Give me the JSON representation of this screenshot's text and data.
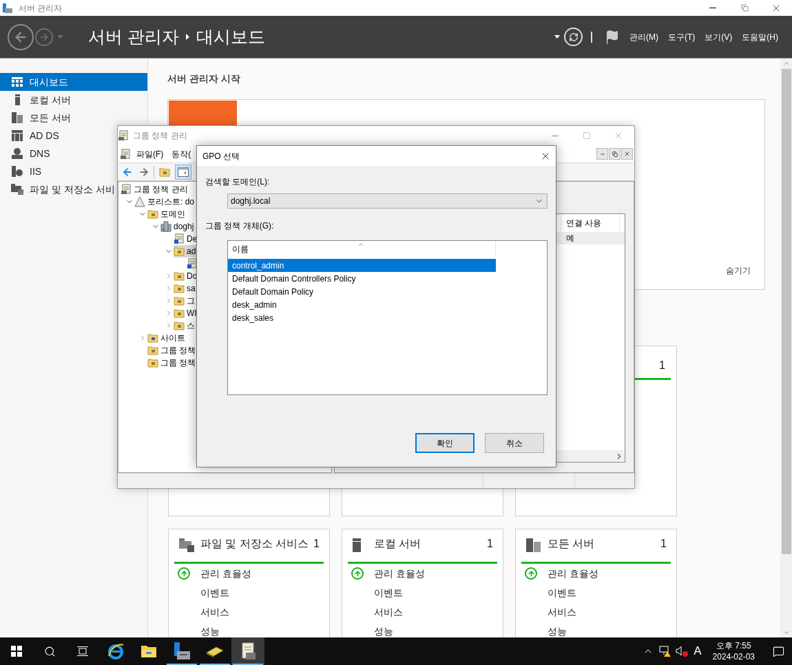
{
  "window": {
    "title": "서버 관리자"
  },
  "header": {
    "breadcrumb": [
      "서버 관리자",
      "대시보드"
    ],
    "menus": [
      "관리(M)",
      "도구(T)",
      "보기(V)",
      "도움말(H)"
    ]
  },
  "sidebar": {
    "items": [
      {
        "label": "대시보드",
        "kind": "dashboard",
        "selected": true
      },
      {
        "label": "로컬 서버",
        "kind": "server",
        "selected": false
      },
      {
        "label": "모든 서버",
        "kind": "servers",
        "selected": false
      },
      {
        "label": "AD DS",
        "kind": "adds",
        "selected": false
      },
      {
        "label": "DNS",
        "kind": "dns",
        "selected": false
      },
      {
        "label": "IIS",
        "kind": "iis",
        "selected": false
      },
      {
        "label": "파일 및 저장소 서비",
        "kind": "files",
        "selected": false
      }
    ]
  },
  "welcome": {
    "title": "서버 관리자 시작",
    "hide_link": "숨기기"
  },
  "middle_tile": {
    "count": "1"
  },
  "tiles": [
    {
      "kind": "files",
      "title": "파일 및 저장소 서비스",
      "count": "1",
      "items": [
        {
          "label": "관리 효율성",
          "ok": true
        },
        {
          "label": "이벤트",
          "ok": false
        },
        {
          "label": "서비스",
          "ok": false
        },
        {
          "label": "성능",
          "ok": false
        }
      ]
    },
    {
      "kind": "server",
      "title": "로컬 서버",
      "count": "1",
      "items": [
        {
          "label": "관리 효율성",
          "ok": true
        },
        {
          "label": "이벤트",
          "ok": false
        },
        {
          "label": "서비스",
          "ok": false
        },
        {
          "label": "성능",
          "ok": false
        }
      ]
    },
    {
      "kind": "servers",
      "title": "모든 서버",
      "count": "1",
      "items": [
        {
          "label": "관리 효율성",
          "ok": true
        },
        {
          "label": "이벤트",
          "ok": false
        },
        {
          "label": "서비스",
          "ok": false
        },
        {
          "label": "성능",
          "ok": false
        }
      ]
    }
  ],
  "gpm": {
    "title": "그룹 정책 관리",
    "menus": [
      "파일(F)",
      "동작("
    ],
    "tree": [
      {
        "label": "그룹 정책 관리",
        "kind": "console",
        "selected": false,
        "children": [
          {
            "label": "포리스트: do",
            "kind": "forest",
            "expanded": true,
            "selected": false,
            "children": [
              {
                "label": "도메인",
                "kind": "domains",
                "expanded": true,
                "selected": false,
                "children": [
                  {
                    "label": "doghj",
                    "kind": "domain",
                    "expanded": true,
                    "selected": false,
                    "children": [
                      {
                        "label": "De",
                        "kind": "link",
                        "selected": false
                      },
                      {
                        "label": "ad",
                        "kind": "ou",
                        "expanded": true,
                        "selected": true,
                        "children": [
                          {
                            "kind": "link",
                            "selected": false
                          }
                        ]
                      },
                      {
                        "label": "Do",
                        "kind": "ou",
                        "expanded": false,
                        "selected": false
                      },
                      {
                        "label": "sa",
                        "kind": "ou",
                        "expanded": false,
                        "selected": false
                      },
                      {
                        "label": "그",
                        "kind": "gpo-folder",
                        "expanded": false,
                        "selected": false
                      },
                      {
                        "label": "WI",
                        "kind": "wmi",
                        "expanded": false,
                        "selected": false
                      },
                      {
                        "label": "스",
                        "kind": "starter",
                        "expanded": false,
                        "selected": false
                      }
                    ]
                  }
                ]
              },
              {
                "label": "사이트",
                "kind": "sites",
                "expanded": false,
                "selected": false
              },
              {
                "label": "그룹 정책",
                "kind": "modeling",
                "selected": false
              },
              {
                "label": "그룹 정책",
                "kind": "results",
                "selected": false
              }
            ]
          }
        ]
      }
    ],
    "columns": [
      "연결 사용"
    ],
    "rows": [
      [
        "예"
      ]
    ]
  },
  "dialog": {
    "title": "GPO 선택",
    "domain_label": "검색할 도메인(L):",
    "domain": "doghj.local",
    "list_label": "그룹 정책 개체(G):",
    "column": "이름",
    "items": [
      {
        "label": "control_admin",
        "selected": true
      },
      {
        "label": "Default Domain Controllers Policy",
        "selected": false
      },
      {
        "label": "Default Domain Policy",
        "selected": false
      },
      {
        "label": "desk_admin",
        "selected": false
      },
      {
        "label": "desk_sales",
        "selected": false
      }
    ],
    "buttons": [
      {
        "label": "확인",
        "default": true
      },
      {
        "label": "취소",
        "default": false
      }
    ]
  },
  "taskbar": {
    "apps": [
      {
        "kind": "ie",
        "running": false,
        "selected": false
      },
      {
        "kind": "explorer",
        "running": false,
        "selected": false
      },
      {
        "kind": "server-manager",
        "running": true,
        "selected": false
      },
      {
        "kind": "notebook",
        "running": true,
        "selected": false
      },
      {
        "kind": "gpm",
        "running": true,
        "selected": true
      }
    ],
    "ime": "A",
    "time": "오후 7:55",
    "date": "2024-02-03"
  }
}
